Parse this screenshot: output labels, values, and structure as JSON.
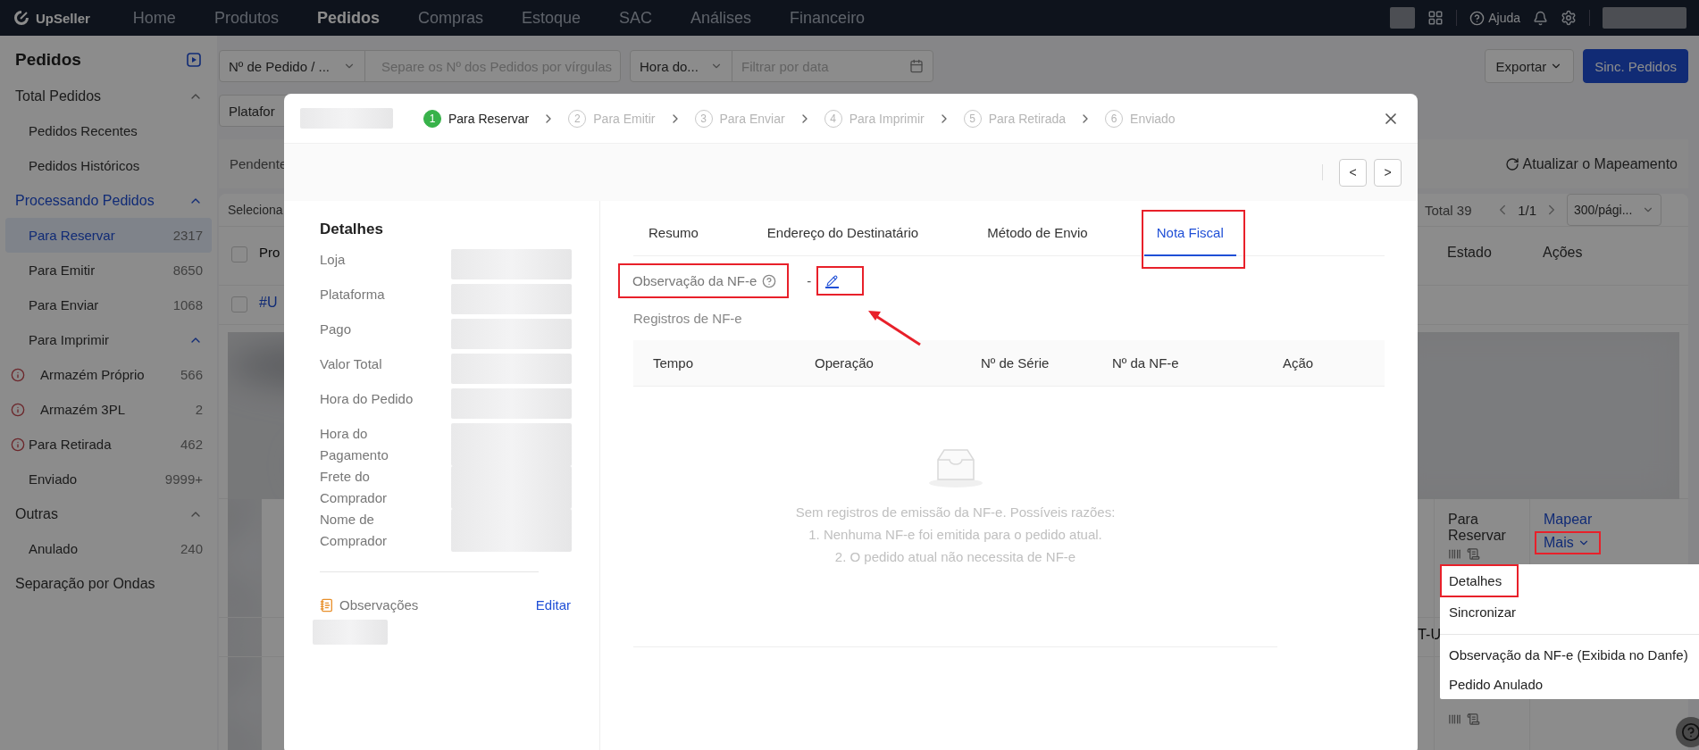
{
  "top_nav": {
    "brand": "UpSeller",
    "items": [
      {
        "label": "Home",
        "selected": false
      },
      {
        "label": "Produtos",
        "selected": false
      },
      {
        "label": "Pedidos",
        "selected": true
      },
      {
        "label": "Compras",
        "selected": false
      },
      {
        "label": "Estoque",
        "selected": false
      },
      {
        "label": "SAC",
        "selected": false
      },
      {
        "label": "Análises",
        "selected": false
      },
      {
        "label": "Financeiro",
        "selected": false
      }
    ],
    "help": "Ajuda"
  },
  "sidebar": {
    "title": "Pedidos",
    "groups": [
      {
        "label": "Total Pedidos",
        "selected": false,
        "expanded": true,
        "children": [
          {
            "label": "Pedidos Recentes",
            "selected": false,
            "warning": false
          },
          {
            "label": "Pedidos Históricos",
            "selected": false,
            "warning": false
          }
        ]
      },
      {
        "label": "Processando Pedidos",
        "selected": true,
        "expanded": true,
        "children": [
          {
            "label": "Para Reservar",
            "count": "2317",
            "selected": true,
            "warning": false
          },
          {
            "label": "Para Emitir",
            "count": "8650",
            "selected": false,
            "warning": false
          },
          {
            "label": "Para Enviar",
            "count": "1068",
            "selected": false,
            "warning": false
          },
          {
            "label": "Para Imprimir",
            "selected": false,
            "warning": false,
            "expanded": true,
            "children": [
              {
                "label": "Armazém Próprio",
                "count": "566",
                "selected": false,
                "warning": true
              },
              {
                "label": "Armazém 3PL",
                "count": "2",
                "selected": false,
                "warning": true
              }
            ]
          },
          {
            "label": "Para Retirada",
            "count": "462",
            "selected": false,
            "warning": true
          },
          {
            "label": "Enviado",
            "count": "9999+",
            "selected": false,
            "warning": false
          }
        ]
      },
      {
        "label": "Outras",
        "selected": false,
        "expanded": true,
        "children": [
          {
            "label": "Anulado",
            "count": "240",
            "selected": false,
            "warning": false
          }
        ]
      },
      {
        "label": "Separação por Ondas",
        "selected": false
      }
    ]
  },
  "filters": {
    "order_field": {
      "value": "Nº de Pedido / ..."
    },
    "order_search": {
      "placeholder": "Separe os Nº dos Pedidos por vírgulas"
    },
    "time_field": {
      "value": "Hora do..."
    },
    "date_filter": {
      "placeholder": "Filtrar por data"
    },
    "platform_field": {
      "value": "Platafor"
    },
    "export_button": "Exportar",
    "sync_button": "Sinc. Pedidos"
  },
  "status_tab": "Pendente",
  "refresh_mapping": "Atualizar o Mapeamento",
  "orders": {
    "header_checked": false,
    "row_checked": false,
    "select_label": "Seleciona",
    "total": "Total 39",
    "page": "1/1",
    "page_size": "300/pági...",
    "columns": [
      "Pro",
      "Estado",
      "Ações"
    ],
    "order_number": "#U",
    "status": "Para Reservar",
    "actions": [
      {
        "label": "Mapear",
        "kind": "link",
        "highlighted": false
      },
      {
        "label": "Mais",
        "kind": "dropdown",
        "highlighted": true
      }
    ],
    "next_order_fragment": "T-U"
  },
  "actions_menu": {
    "items": [
      {
        "label": "Detalhes",
        "highlighted": true,
        "divider_before": false
      },
      {
        "label": "Sincronizar",
        "highlighted": false,
        "divider_before": false
      },
      {
        "label": "Observação da NF-e (Exibida no Danfe)",
        "highlighted": false,
        "divider_before": true
      },
      {
        "label": "Pedido Anulado",
        "highlighted": false,
        "divider_before": false
      }
    ]
  },
  "modal": {
    "steps": [
      {
        "number": "1",
        "label": "Para Reservar",
        "selected": true
      },
      {
        "number": "2",
        "label": "Para Emitir",
        "selected": false
      },
      {
        "number": "3",
        "label": "Para Enviar",
        "selected": false
      },
      {
        "number": "4",
        "label": "Para Imprimir",
        "selected": false
      },
      {
        "number": "5",
        "label": "Para Retirada",
        "selected": false
      },
      {
        "number": "6",
        "label": "Enviado",
        "selected": false
      }
    ],
    "pager": {
      "prev": "<",
      "next": ">"
    },
    "details": {
      "title": "Detalhes",
      "fields": [
        "Loja",
        "Plataforma",
        "Pago",
        "Valor Total",
        "Hora do Pedido",
        "Hora do Pagamento",
        "Frete do Comprador",
        "Nome de Comprador"
      ]
    },
    "notes": {
      "label": "Observações",
      "action": "Editar"
    },
    "tabs": [
      {
        "label": "Resumo",
        "selected": false,
        "highlighted": false
      },
      {
        "label": "Endereço do Destinatário",
        "selected": false,
        "highlighted": false
      },
      {
        "label": "Método de Envio",
        "selected": false,
        "highlighted": false
      },
      {
        "label": "Nota Fiscal",
        "selected": true,
        "highlighted": true
      }
    ],
    "nfe_note": {
      "label": "Observação da NF-e",
      "highlighted": true,
      "value": "-",
      "edit_highlighted": true
    },
    "records": {
      "title": "Registros de NF-e",
      "columns": [
        "Tempo",
        "Operação",
        "Nº de Série",
        "Nº da NF-e",
        "Ação"
      ],
      "empty_lines": [
        "Sem registros de emissão da NF-e. Possíveis razões:",
        "1. Nenhuma NF-e foi emitida para o pedido atual.",
        "2. O pedido atual não necessita de NF-e"
      ]
    }
  }
}
